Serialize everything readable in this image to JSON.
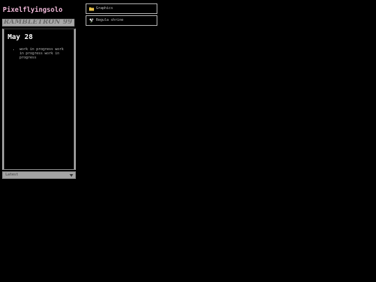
{
  "site": {
    "title": "Pixelflyingsolo"
  },
  "banner": {
    "text": "RAMBLETRON 99"
  },
  "post": {
    "date": "May 28",
    "items": [
      "work in progress work in progress work in progress"
    ]
  },
  "archive_select": {
    "selected": "Latest"
  },
  "nav": {
    "links": [
      {
        "label": "Graphics",
        "icon": "folder-icon"
      },
      {
        "label": "Regula shrine",
        "icon": "flower-icon"
      }
    ]
  },
  "colors": {
    "background": "#000000",
    "title": "#f0b8d8",
    "banner_bg": "#a9a9a9",
    "frame_border": "#9a9a9a",
    "nav_border": "#bfbfbf"
  }
}
